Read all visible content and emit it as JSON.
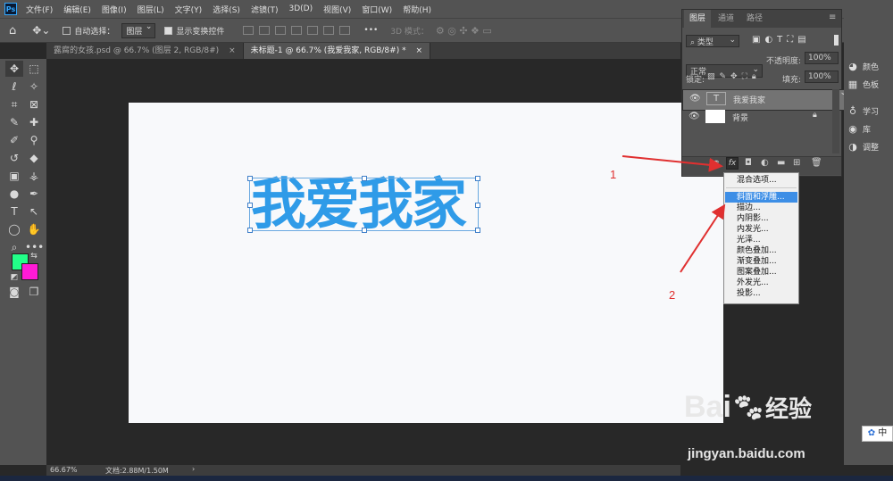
{
  "menubar": {
    "logo": "Ps",
    "items": [
      "文件(F)",
      "编辑(E)",
      "图像(I)",
      "图层(L)",
      "文字(Y)",
      "选择(S)",
      "滤镜(T)",
      "3D(D)",
      "视图(V)",
      "窗口(W)",
      "帮助(H)"
    ]
  },
  "options": {
    "auto_select_label": "自动选择：",
    "auto_select_value": "图层",
    "show_transform_label": "显示变换控件",
    "more": "•••",
    "mode3d_label": "3D 模式："
  },
  "tabs": [
    {
      "label": "露腐的女孩.psd @ 66.7% (图层 2, RGB/8#)"
    },
    {
      "label": "未标题-1 @ 66.7% (我爱我家, RGB/8#) *"
    }
  ],
  "canvas": {
    "text": "我爱我家",
    "text_color": "#2f9be8"
  },
  "status": {
    "zoom": "66.67%",
    "doc": "文档:2.88M/1.50M",
    "arrow": "›"
  },
  "layers_panel": {
    "tabs": [
      "图层",
      "通道",
      "路径"
    ],
    "filter_kind": "类型",
    "blend_mode": "正常",
    "opacity_label": "不透明度:",
    "opacity_value": "100%",
    "lock_label": "锁定:",
    "fill_label": "填充:",
    "fill_value": "100%",
    "layers": [
      {
        "name": "我爱我家",
        "thumb": "T"
      },
      {
        "name": "背景"
      }
    ],
    "fx": "fx"
  },
  "context_menu": {
    "items": [
      "混合选项...",
      "斜面和浮雕...",
      "描边...",
      "内阴影...",
      "内发光...",
      "光泽...",
      "颜色叠加...",
      "渐变叠加...",
      "图案叠加...",
      "外发光...",
      "投影..."
    ],
    "highlighted": "斜面和浮雕..."
  },
  "right_panel": {
    "items": [
      "颜色",
      "色板",
      "学习",
      "库",
      "调整"
    ]
  },
  "annotations": {
    "label1": "1",
    "label2": "2",
    "color": "#e03030"
  },
  "watermark": {
    "logo": "Bai",
    "logo_cn": "经验",
    "url": "jingyan.baidu.com"
  },
  "ime": "中",
  "colors": {
    "foreground": "#22ff88",
    "background": "#ff1ad6"
  }
}
